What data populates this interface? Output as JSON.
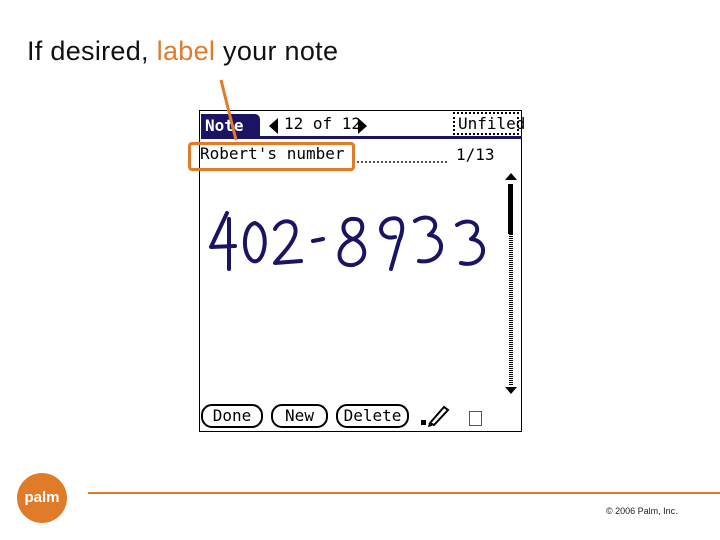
{
  "slide": {
    "title_pre": "If desired, ",
    "title_highlight": "label",
    "title_post": " your note",
    "accent_color": "#e07b2a"
  },
  "device": {
    "tab_label": "Note",
    "counter": "12 of 12",
    "category": "Unfiled",
    "note_title": "Robert's number",
    "page_indicator": "1/13",
    "handwriting": "402-8933",
    "buttons": {
      "done": "Done",
      "new": "New",
      "delete": "Delete"
    },
    "icons": [
      "prev-arrow-icon",
      "next-arrow-icon",
      "scroll-up-icon",
      "scroll-down-icon",
      "pen-icon"
    ]
  },
  "footer": {
    "logo_text": "palm",
    "copyright": "© 2006 Palm, Inc."
  }
}
